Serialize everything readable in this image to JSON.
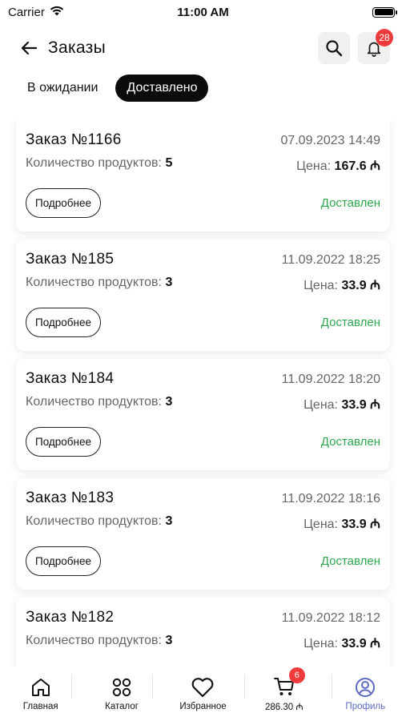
{
  "status_bar": {
    "carrier": "Carrier",
    "time": "11:00 AM"
  },
  "header": {
    "title": "Заказы",
    "notifications_count": "28"
  },
  "tabs": [
    {
      "label": "В ожидании",
      "active": false
    },
    {
      "label": "Доставлено",
      "active": true
    }
  ],
  "order_labels": {
    "products_count": "Количество продуктов:",
    "price": "Цена:",
    "details_button": "Подробнее",
    "currency": "₼"
  },
  "orders": [
    {
      "title": "Заказ №1166",
      "date": "07.09.2023 14:49",
      "products": "5",
      "price": "167.6 ₼",
      "status": "Доставлен"
    },
    {
      "title": "Заказ №185",
      "date": "11.09.2022 18:25",
      "products": "3",
      "price": "33.9 ₼",
      "status": "Доставлен"
    },
    {
      "title": "Заказ №184",
      "date": "11.09.2022 18:20",
      "products": "3",
      "price": "33.9 ₼",
      "status": "Доставлен"
    },
    {
      "title": "Заказ №183",
      "date": "11.09.2022 18:16",
      "products": "3",
      "price": "33.9 ₼",
      "status": "Доставлен"
    },
    {
      "title": "Заказ №182",
      "date": "11.09.2022 18:12",
      "products": "3",
      "price": "33.9 ₼",
      "status": ""
    }
  ],
  "bottom_nav": [
    {
      "label": "Главная",
      "icon": "home-icon"
    },
    {
      "label": "Каталог",
      "icon": "catalog-icon"
    },
    {
      "label": "Избранное",
      "icon": "heart-icon"
    },
    {
      "label": "286.30 ₼",
      "icon": "cart-icon",
      "badge": "6"
    },
    {
      "label": "Профиль",
      "icon": "profile-icon",
      "active": true
    }
  ],
  "colors": {
    "accent": "#5c6bc0",
    "badge": "#ef3b3b",
    "delivered": "#2fa84f"
  }
}
